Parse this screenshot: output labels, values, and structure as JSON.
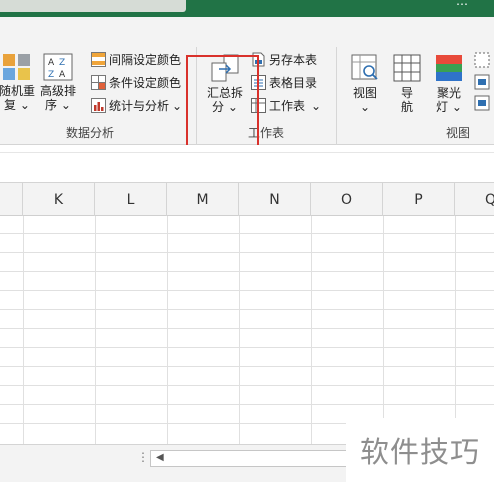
{
  "title_bar": {
    "overflow_glyph": "…"
  },
  "ribbon": {
    "data_analysis": {
      "random_repeat_label_1": "随机重",
      "random_repeat_label_2": "复",
      "advanced_sort_label_1": "高级排",
      "advanced_sort_label_2": "序",
      "interval_color": "间隔设定颜色",
      "conditional_color": "条件设定颜色",
      "stats_analysis": "统计与分析",
      "group_label": "数据分析"
    },
    "worksheet": {
      "merge_split_label_1": "汇总拆",
      "merge_split_label_2": "分",
      "save_sheet": "另存本表",
      "sheet_directory": "表格目录",
      "worksheet": "工作表",
      "group_label": "工作表"
    },
    "view": {
      "view_label": "视图",
      "nav_label_1": "导",
      "nav_label_2": "航",
      "spotlight_label_1": "聚光",
      "spotlight_label_2": "灯",
      "group_label": "视图"
    },
    "dropdown_glyph": "⌄"
  },
  "columns": [
    "K",
    "L",
    "M",
    "N",
    "O",
    "P",
    "Q"
  ],
  "scroll": {
    "dots": "⋮",
    "left_arrow": "◀"
  },
  "watermark": "软件技巧",
  "colors": {
    "title_bar": "#217346",
    "highlight": "#d9312b"
  }
}
